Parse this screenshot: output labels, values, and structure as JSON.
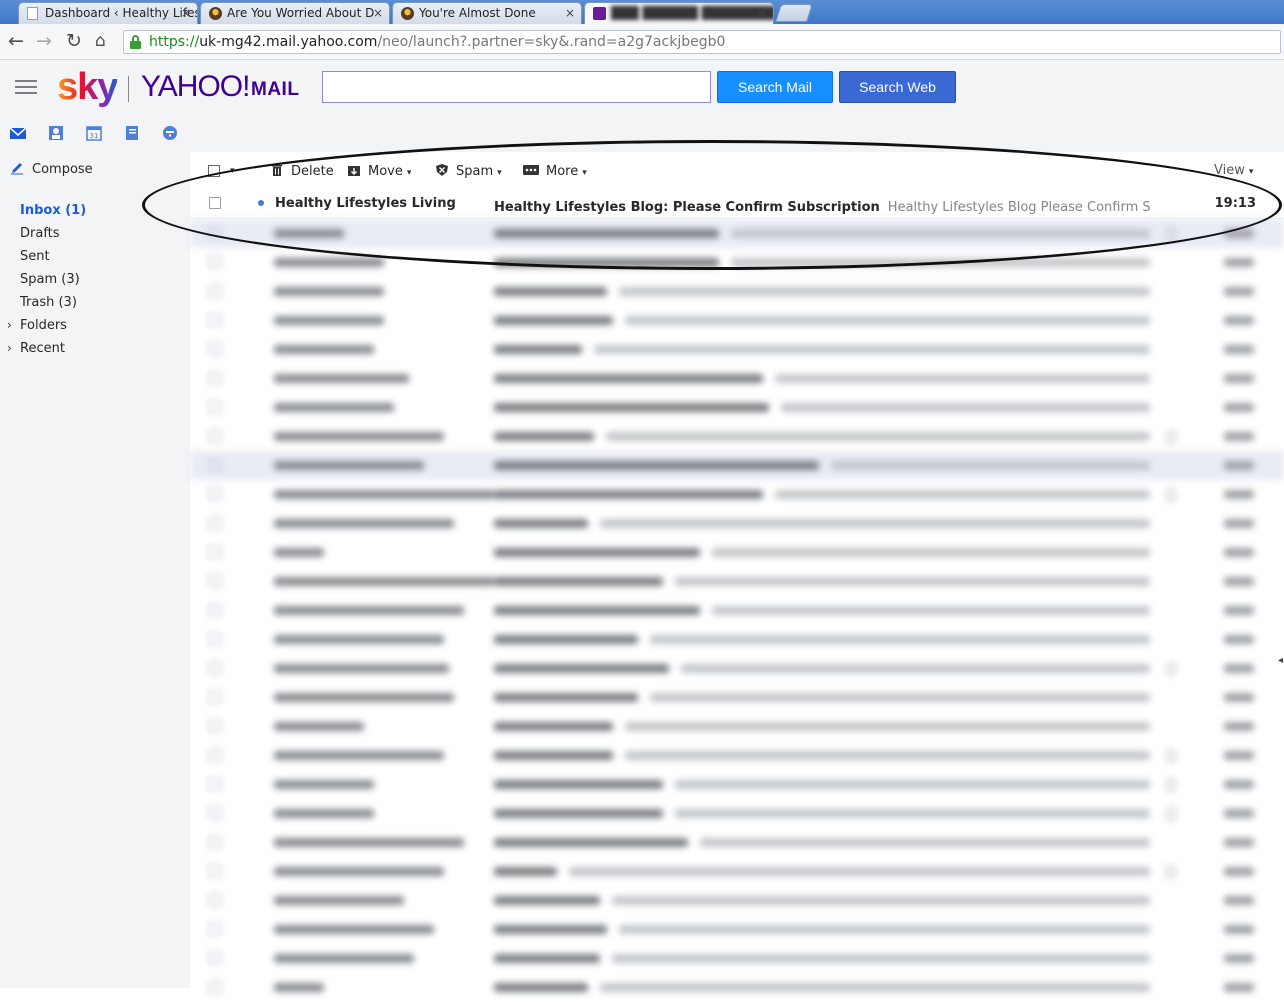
{
  "browser": {
    "tabs": [
      {
        "title": "Dashboard ‹ Healthy Lifes",
        "icon": "document-icon"
      },
      {
        "title": "Are You Worried About D",
        "icon": "site-icon"
      },
      {
        "title": "You're Almost Done",
        "icon": "site-icon"
      },
      {
        "title": "",
        "icon": "yahoo-mail-icon"
      }
    ],
    "tab_close": "×",
    "url_scheme": "https://",
    "url_host": "uk-mg42.mail.yahoo.com",
    "url_path": "/neo/launch?.partner=sky&.rand=a2g7ackjbegb0"
  },
  "header": {
    "logo_sky": "sky",
    "logo_yahoo": "YAHOO!",
    "logo_mail": "MAIL",
    "search_value": "",
    "search_mail_label": "Search Mail",
    "search_web_label": "Search Web",
    "apps": [
      "mail-icon",
      "contacts-icon",
      "calendar-icon",
      "notepad-icon",
      "messenger-icon"
    ],
    "calendar_day": "31"
  },
  "sidebar": {
    "compose_label": "Compose",
    "inbox_label": "Inbox (1)",
    "drafts_label": "Drafts",
    "sent_label": "Sent",
    "spam_label": "Spam (3)",
    "trash_label": "Trash (3)",
    "folders_label": "Folders",
    "recent_label": "Recent"
  },
  "toolbar": {
    "delete_label": "Delete",
    "move_label": "Move",
    "spam_label": "Spam",
    "more_label": "More",
    "view_label": "View"
  },
  "messages": {
    "first": {
      "from": "Healthy Lifestyles Living",
      "subject": "Healthy Lifestyles Blog: Please Confirm Subscription",
      "snippet": "Healthy Lifestyles Blog Please Confirm Subscription Yes, s",
      "time": "19:13",
      "unread": true
    }
  },
  "colors": {
    "accent": "#188fff",
    "brand_purple": "#400090",
    "inbox_blue": "#1d5bd6"
  }
}
